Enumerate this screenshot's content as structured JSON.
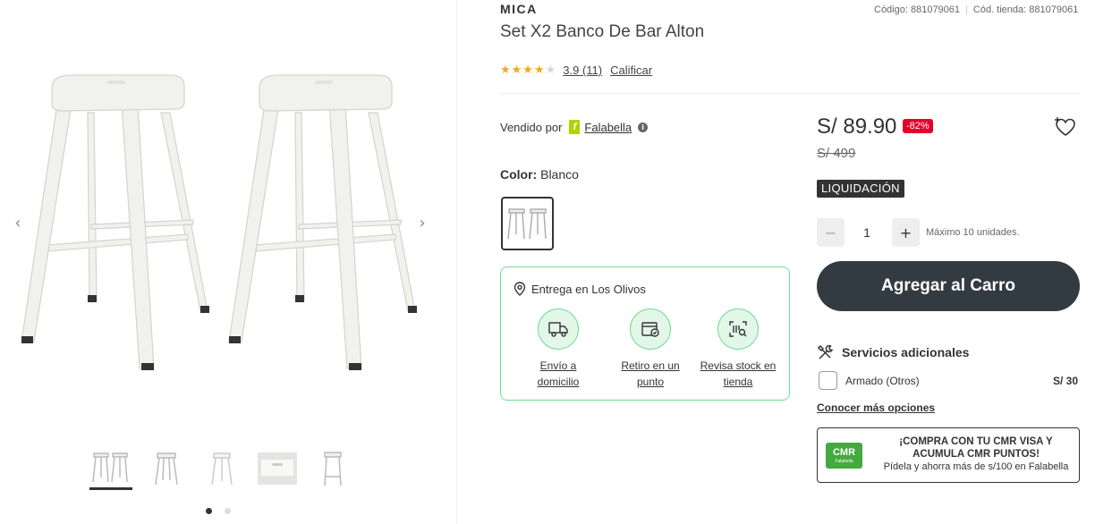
{
  "gallery": {
    "thumbnails": [
      "thumb-1",
      "thumb-2",
      "thumb-3",
      "thumb-4",
      "thumb-5"
    ],
    "active_thumbnail": 1,
    "dots": 2,
    "active_dot": 1
  },
  "product": {
    "brand": "MICA",
    "title": "Set X2 Banco De Bar Alton",
    "codes": {
      "code": "Código: 881079061",
      "store_code": "Cód. tienda: 881079061"
    },
    "rating": {
      "stars": 3.9,
      "value_text": "3.9 (11)",
      "rate_label": "Calificar"
    }
  },
  "seller": {
    "label": "Vendido por",
    "name": "Falabella"
  },
  "color": {
    "label": "Color:",
    "value": "Blanco"
  },
  "delivery": {
    "location": "Entrega en Los Olivos",
    "options": [
      {
        "line1": "Envío a",
        "line2": "domicilio",
        "icon": "truck-icon"
      },
      {
        "line1": "Retiro en un",
        "line2": "punto",
        "icon": "store-pickup-icon"
      },
      {
        "line1": "Revisa stock en",
        "line2": "tienda",
        "icon": "stock-search-icon"
      }
    ]
  },
  "pricing": {
    "price": "S/ 89.90",
    "discount": "-82%",
    "old_price": "S/ 499",
    "badge": "LIQUIDACIÓN"
  },
  "quantity": {
    "minus": "−",
    "value": "1",
    "plus": "+",
    "max_text": "Máximo 10 unidades."
  },
  "cart": {
    "add_label": "Agregar al Carro"
  },
  "services": {
    "title": "Servicios adicionales",
    "items": [
      {
        "name": "Armado (Otros)",
        "price": "S/ 30"
      }
    ],
    "more_label": "Conocer más opciones"
  },
  "cmr": {
    "logo_main": "CMR",
    "logo_sub": "Falabella",
    "line1": "¡COMPRA CON TU CMR VISA Y",
    "line2": "ACUMULA CMR PUNTOS!",
    "line3": "Pídela y ahorra más de s/100 en Falabella"
  },
  "colors": {
    "accent_dark": "#333b42",
    "discount_red": "#e4002b",
    "delivery_green": "#6fdc95",
    "star": "#f5a623",
    "falabella_green": "#aad500",
    "cmr_green": "#44a93e"
  }
}
